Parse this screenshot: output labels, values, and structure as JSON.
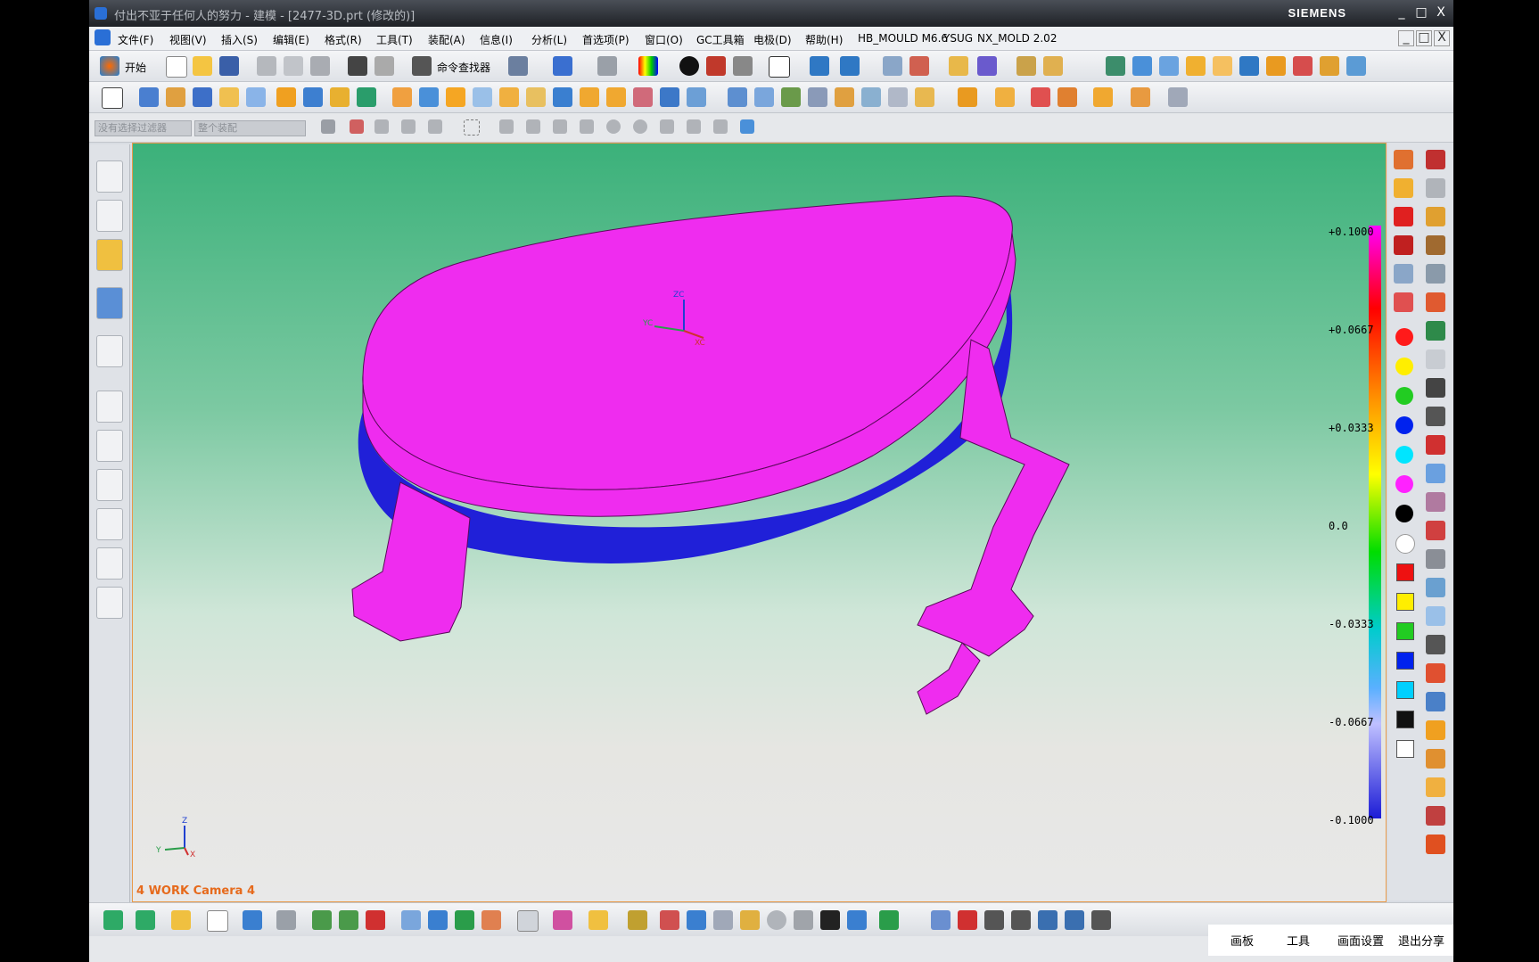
{
  "window": {
    "title": "付出不亚于任何人的努力 - 建模 - [2477-3D.prt (修改的)]",
    "brand": "SIEMENS",
    "controls": [
      "_",
      "□",
      "X"
    ]
  },
  "menu": {
    "items": [
      "文件(F)",
      "视图(V)",
      "插入(S)",
      "编辑(E)",
      "格式(R)",
      "工具(T)",
      "装配(A)",
      "信息(I)",
      "分析(L)",
      "首选项(P)",
      "窗口(O)",
      "GC工具箱",
      "电极(D)",
      "帮助(H)",
      "HB_MOULD M6.6",
      "YSUG",
      "NX_MOLD 2.02"
    ]
  },
  "toolbar": {
    "start_label": "开始",
    "command_finder_label": "命令查找器"
  },
  "selection_bar": {
    "filter_placeholder": "没有选择过滤器",
    "assembly_placeholder": "整个装配"
  },
  "viewport": {
    "camera_label": "4 WORK Camera 4",
    "triad_labels": [
      "Z",
      "Y",
      "X"
    ],
    "wcs_labels": [
      "ZC",
      "YC",
      "XC"
    ]
  },
  "scale": {
    "values": [
      "+0.1000",
      "+0.0667",
      "+0.0333",
      "0.0",
      "-0.0333",
      "-0.0667",
      "-0.1000"
    ]
  },
  "palette": {
    "colors": [
      "#ff1a1a",
      "#ffee00",
      "#22cc22",
      "#0022ee",
      "#00e5ff",
      "#ff22ff",
      "#000000",
      "#ffffff"
    ],
    "cube_colors": [
      "#ee1111",
      "#ffee00",
      "#22cc22",
      "#0022ee",
      "#00d0ff",
      "#111111",
      "#ffffff"
    ]
  },
  "model": {
    "top_color": "#ef2cef",
    "side_color": "#2020d8"
  },
  "footer": {
    "buttons": [
      "画板",
      "工具",
      "画面设置",
      "退出分享"
    ]
  }
}
